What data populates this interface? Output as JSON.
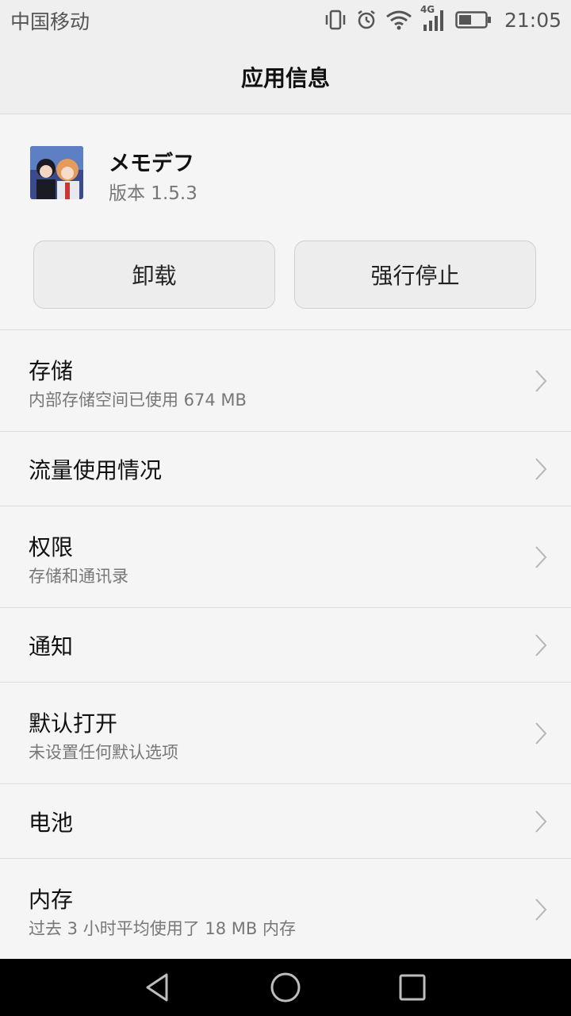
{
  "status_bar": {
    "carrier": "中国移动",
    "network_label": "4G",
    "time": "21:05",
    "icons": [
      "vibrate-icon",
      "alarm-icon",
      "wifi-icon",
      "cellular-signal-icon",
      "battery-icon"
    ]
  },
  "title_bar": {
    "title": "应用信息"
  },
  "app": {
    "name": "メモデフ",
    "version": "版本 1.5.3",
    "icon": "app-icon-anime-characters"
  },
  "actions": {
    "uninstall_label": "卸载",
    "force_stop_label": "强行停止"
  },
  "settings": [
    {
      "title": "存储",
      "subtitle": "内部存储空间已使用 674 MB"
    },
    {
      "title": "流量使用情况",
      "subtitle": ""
    },
    {
      "title": "权限",
      "subtitle": "存储和通讯录"
    },
    {
      "title": "通知",
      "subtitle": ""
    },
    {
      "title": "默认打开",
      "subtitle": "未设置任何默认选项"
    },
    {
      "title": "电池",
      "subtitle": ""
    },
    {
      "title": "内存",
      "subtitle": "过去 3 小时平均使用了 18 MB 内存"
    }
  ],
  "nav_bar": {
    "icons": [
      "back-icon",
      "home-icon",
      "recent-apps-icon"
    ]
  },
  "colors": {
    "background": "#f5f5f5",
    "bar_background": "#efefef",
    "divider": "#dcdcdc",
    "nav_background": "#000000"
  }
}
